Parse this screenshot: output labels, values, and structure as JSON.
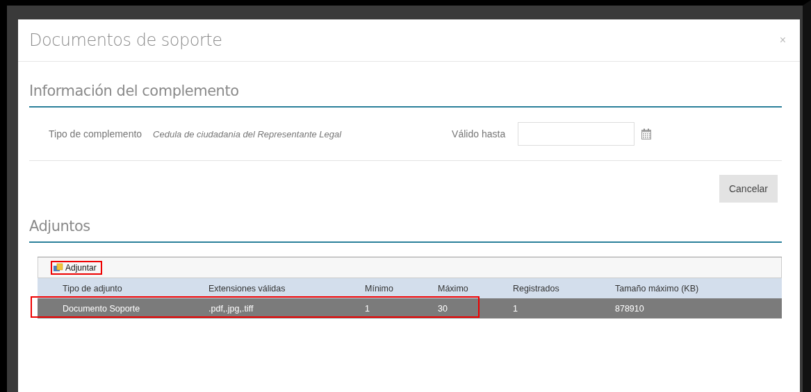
{
  "dialog": {
    "title": "Documentos de soporte",
    "close": "×"
  },
  "info_section": {
    "heading": "Información del complemento",
    "type_label": "Tipo de complemento",
    "type_value": "Cedula de ciudadania del Representante Legal",
    "valid_label": "Válido hasta",
    "cancel": "Cancelar"
  },
  "attachments": {
    "heading": "Adjuntos",
    "attach_button": {
      "label": "Adjuntar",
      "annotated": true
    },
    "columns": [
      "Tipo de adjunto",
      "Extensiones válidas",
      "Mínimo",
      "Máximo",
      "Registrados",
      "Tamaño máximo (KB)"
    ],
    "rows": [
      {
        "cells": [
          "Documento Soporte",
          ".pdf,.jpg,.tiff",
          "1",
          "30",
          "1",
          "878910"
        ],
        "selected": true,
        "annotated": true
      }
    ]
  }
}
